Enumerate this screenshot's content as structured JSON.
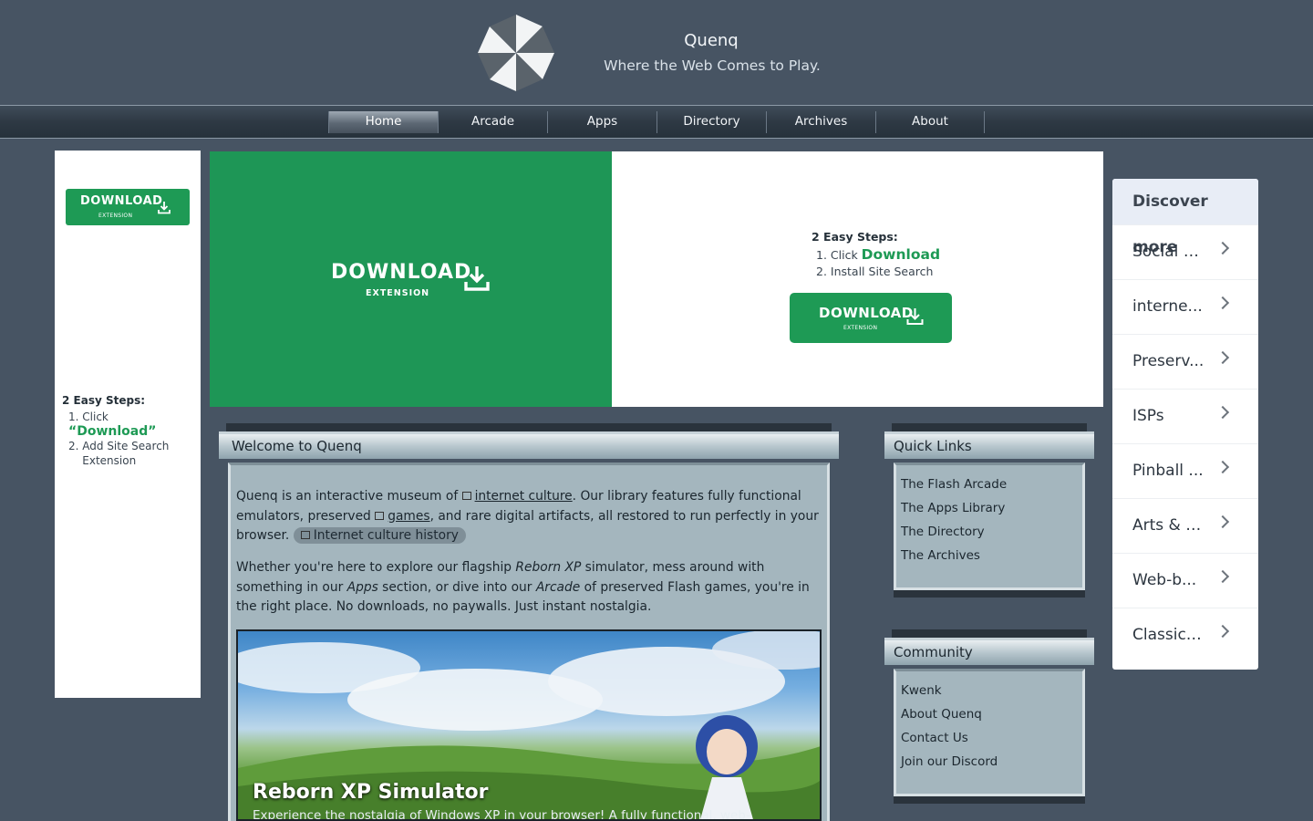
{
  "site": {
    "title": "Quenq",
    "tagline": "Where the Web Comes to Play."
  },
  "nav": {
    "items": [
      "Home",
      "Arcade",
      "Apps",
      "Directory",
      "Archives",
      "About"
    ],
    "active": "Home"
  },
  "left_ad": {
    "button_main": "DOWNLOAD",
    "button_sub": "EXTENSION",
    "steps_title": "2 Easy Steps:",
    "step1_prefix": "Click ",
    "step1_link": "“Download”",
    "step2": "Add Site Search Extension"
  },
  "banner": {
    "main": "DOWNLOAD",
    "sub": "EXTENSION",
    "steps_title": "2 Easy Steps:",
    "step1_prefix": "Click ",
    "step1_link": "Download",
    "step2": "Install Site Search",
    "button_main": "DOWNLOAD",
    "button_sub": "EXTENSION"
  },
  "welcome": {
    "title": "Welcome to Quenq",
    "p1_a": "Quenq is an interactive museum of ",
    "p1_link1": "internet culture",
    "p1_b": ". Our library features fully functional emulators, preserved ",
    "p1_link2": "games",
    "p1_c": ", and rare digital artifacts, all restored to run perfectly in your browser. ",
    "p1_chip": "Internet culture history",
    "p2_a": "Whether you're here to explore our flagship ",
    "p2_em1": "Reborn XP",
    "p2_b": " simulator, mess around with something in our ",
    "p2_em2": "Apps",
    "p2_c": " section, or dive into our ",
    "p2_em3": "Arcade",
    "p2_d": " of preserved Flash games, you're in the right place. No downloads, no paywalls. Just instant nostalgia.",
    "hero_title": "Reborn XP Simulator",
    "hero_desc": "Experience the nostalgia of Windows XP in your browser! A fully functional, web-"
  },
  "quick_links": {
    "title": "Quick Links",
    "items": [
      "The Flash Arcade",
      "The Apps Library",
      "The Directory",
      "The Archives"
    ]
  },
  "community": {
    "title": "Community",
    "items": [
      "Kwenk",
      "About Quenq",
      "Contact Us",
      "Join our Discord"
    ]
  },
  "discover": {
    "title": "Discover more",
    "items": [
      "Social S...",
      "interne...",
      "Preserv...",
      "ISPs",
      "Pinball ...",
      "Arts & E...",
      "Web-b...",
      "Classic ..."
    ]
  },
  "colors": {
    "brand_green": "#1e9a55",
    "page_bg": "#475463",
    "panel_bg": "#a4b6be"
  }
}
